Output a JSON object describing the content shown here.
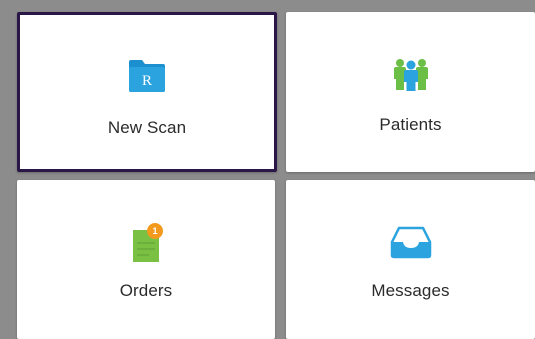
{
  "tiles": [
    {
      "label": "New Scan",
      "icon": "rx-folder-icon",
      "selected": true
    },
    {
      "label": "Patients",
      "icon": "patients-group-icon",
      "selected": false
    },
    {
      "label": "Orders",
      "icon": "orders-clipboard-icon",
      "selected": false,
      "badge": "1"
    },
    {
      "label": "Messages",
      "icon": "inbox-tray-icon",
      "selected": false
    }
  ],
  "colors": {
    "selected_border": "#2a1747",
    "icon_blue": "#2aa3df",
    "orders_green": "#7ac143",
    "badge_orange": "#f39a1e",
    "patients_green": "#6cbf46"
  },
  "icon_text": {
    "rx": "R"
  }
}
